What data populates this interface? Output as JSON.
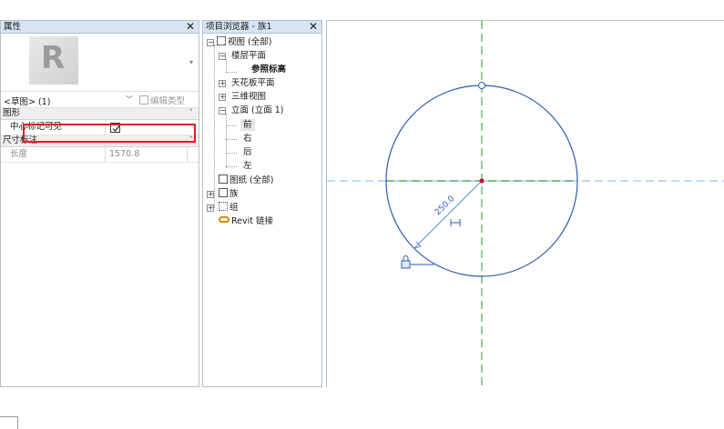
{
  "properties": {
    "title": "属性",
    "close_glyph": "✕",
    "type_logo_letter": "R",
    "instance_selector": "<草图> (1)",
    "edit_type_label": "编辑类型",
    "groups": [
      {
        "name": "图形",
        "params": [
          {
            "name": "中心标记可见",
            "value_type": "checkbox",
            "checked": true
          }
        ]
      },
      {
        "name": "尺寸标注",
        "params": [
          {
            "name": "长度",
            "value": "1570.8"
          }
        ]
      }
    ]
  },
  "browser": {
    "title": "项目浏览器 - 族1",
    "close_glyph": "✕",
    "items": {
      "views_all": "视图 (全部)",
      "floor_plans": "楼层平面",
      "ref_level": "参照标高",
      "ceiling_plans": "天花板平面",
      "views_3d": "三维视图",
      "elevations": "立面 (立面 1)",
      "front": "前",
      "right": "右",
      "back": "后",
      "left": "左",
      "sheets": "图纸 (全部)",
      "families": "族",
      "groups": "组",
      "revit_links": "Revit 链接"
    }
  },
  "canvas": {
    "dimension_text": "250.0",
    "colors": {
      "circle": "#2a5db0",
      "ref_plane": "#2f9a3a",
      "center_mark": "#c0123a",
      "dimension": "#5a8fd8"
    }
  }
}
